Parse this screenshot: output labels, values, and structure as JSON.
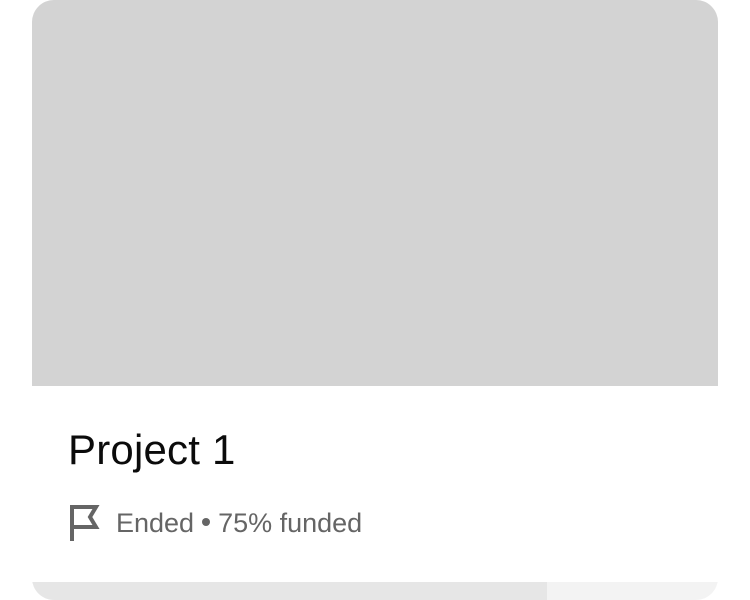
{
  "project": {
    "title": "Project 1",
    "status": "Ended",
    "funded_label": "75% funded",
    "funded_fraction": 0.75,
    "status_icon": "flag-icon"
  },
  "colors": {
    "thumbnail": "#d3d3d3",
    "title_text": "#0b0b0b",
    "meta_text": "#656565",
    "progress_track": "#f3f3f3",
    "progress_fill": "#e6e6e6"
  }
}
